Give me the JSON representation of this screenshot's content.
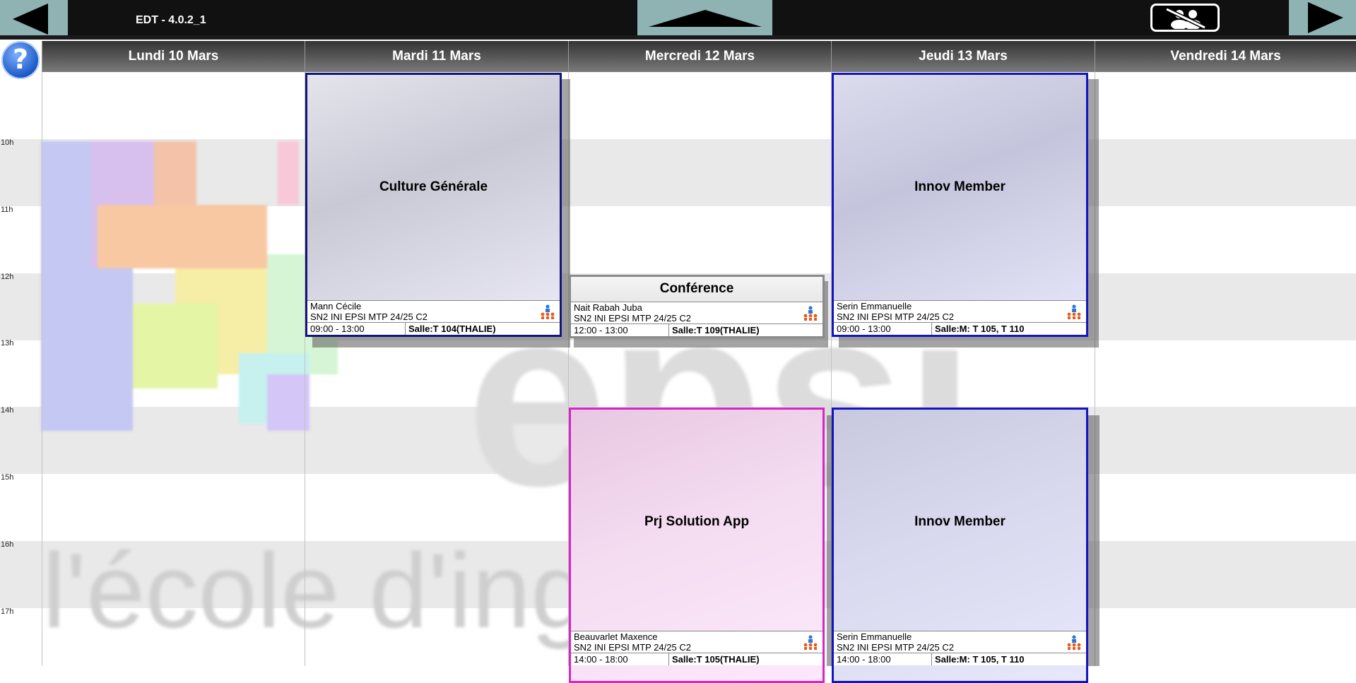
{
  "app": {
    "version": "EDT - 4.0.2_1"
  },
  "help": {
    "label": "?"
  },
  "days": [
    {
      "label": "Lundi 10 Mars"
    },
    {
      "label": "Mardi 11 Mars"
    },
    {
      "label": "Mercredi 12 Mars"
    },
    {
      "label": "Jeudi 13 Mars"
    },
    {
      "label": "Vendredi 14 Mars"
    }
  ],
  "hours": [
    "10h",
    "11h",
    "12h",
    "13h",
    "14h",
    "15h",
    "16h",
    "17h"
  ],
  "watermark": {
    "text": "l'école d'ing",
    "logo": "epsi"
  },
  "events": [
    {
      "title": "Culture Générale",
      "teacher": "Mann Cécile",
      "group": "SN2 INI EPSI MTP 24/25 C2",
      "time": "09:00 - 13:00",
      "room": "Salle:T 104(THALIE)"
    },
    {
      "title": "Conférence",
      "teacher": "Nait Rabah Juba",
      "group": "SN2 INI EPSI MTP 24/25 C2",
      "time": "12:00 - 13:00",
      "room": "Salle:T 109(THALIE)"
    },
    {
      "title": "Innov Member",
      "teacher": "Serin Emmanuelle",
      "group": "SN2 INI EPSI MTP 24/25 C2",
      "time": "09:00 - 13:00",
      "room": "Salle:M: T 105, T 110"
    },
    {
      "title": "Prj Solution App",
      "teacher": "Beauvarlet Maxence",
      "group": "SN2 INI EPSI MTP 24/25 C2",
      "time": "14:00 - 18:00",
      "room": "Salle:T 105(THALIE)"
    },
    {
      "title": "Innov Member",
      "teacher": "Serin Emmanuelle",
      "group": "SN2 INI EPSI MTP 24/25 C2",
      "time": "14:00 - 18:00",
      "room": "Salle:M: T 105, T 110"
    }
  ]
}
